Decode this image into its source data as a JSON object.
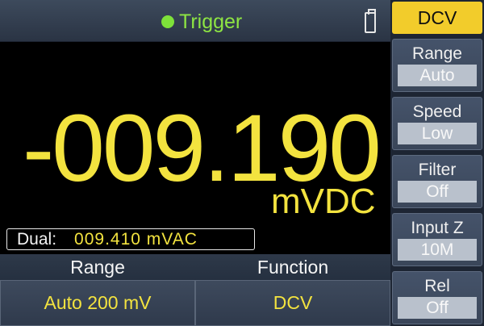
{
  "header": {
    "trigger_label": "Trigger",
    "trigger_color": "#7ee13a"
  },
  "measurement": {
    "reading": "-009.190",
    "unit": "mVDC",
    "dual_label": "Dual:",
    "dual_value": "009.410 mVAC",
    "color": "#f3e33f"
  },
  "softkeys": [
    {
      "title": "Range",
      "value": "Auto 200 mV"
    },
    {
      "title": "Function",
      "value": "DCV"
    }
  ],
  "sidebar": {
    "active_function": "DCV",
    "items": [
      {
        "label": "Range",
        "value": "Auto"
      },
      {
        "label": "Speed",
        "value": "Low"
      },
      {
        "label": "Filter",
        "value": "Off"
      },
      {
        "label": "Input Z",
        "value": "10M"
      },
      {
        "label": "Rel",
        "value": "Off"
      }
    ]
  }
}
